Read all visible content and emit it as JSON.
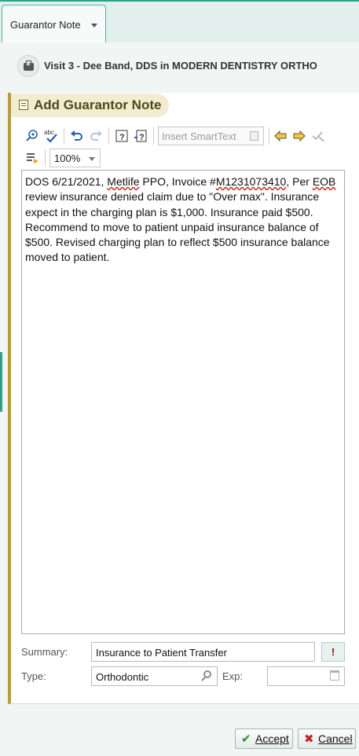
{
  "tab": {
    "label": "Guarantor Note"
  },
  "visit": {
    "title": "Visit 3 - Dee Band, DDS in MODERN DENTISTRY ORTHO"
  },
  "panel": {
    "title": "Add Guarantor Note"
  },
  "toolbar": {
    "insert_smarttext": "Insert SmartText",
    "zoom_value": "100%",
    "icons": [
      "find-replace-icon",
      "spellcheck-icon",
      "undo-icon",
      "redo-icon",
      "help-icon",
      "help-context-icon",
      "smartlist-icon",
      "previous-icon",
      "next-icon",
      "accept-all-icon",
      "more-icon",
      "zoom-dropdown"
    ]
  },
  "note": {
    "segments": [
      "DOS 6/21/2021, ",
      "Metlife",
      " PPO, Invoice #",
      "M1231073410",
      ", Per ",
      "EOB",
      " review insurance denied claim due to \"Over max\". Insurance expect in the charging plan is $1,000. Insurance paid $500. Recommend to move to patient unpaid insurance balance of $500. Revised charging plan to reflect $500 insurance balance moved to patient."
    ]
  },
  "form": {
    "summary_label": "Summary:",
    "summary_value": "Insurance to Patient Transfer",
    "required_marker": "!",
    "type_label": "Type:",
    "type_value": "Orthodontic",
    "exp_label": "Exp:",
    "exp_value": ""
  },
  "buttons": {
    "accept_label": "Accept",
    "cancel_label": "Cancel"
  },
  "colors": {
    "accent_green": "#2ea287",
    "panel_accent": "#b59c45",
    "header_text": "#4f4a1e",
    "error_red": "#d02020"
  }
}
